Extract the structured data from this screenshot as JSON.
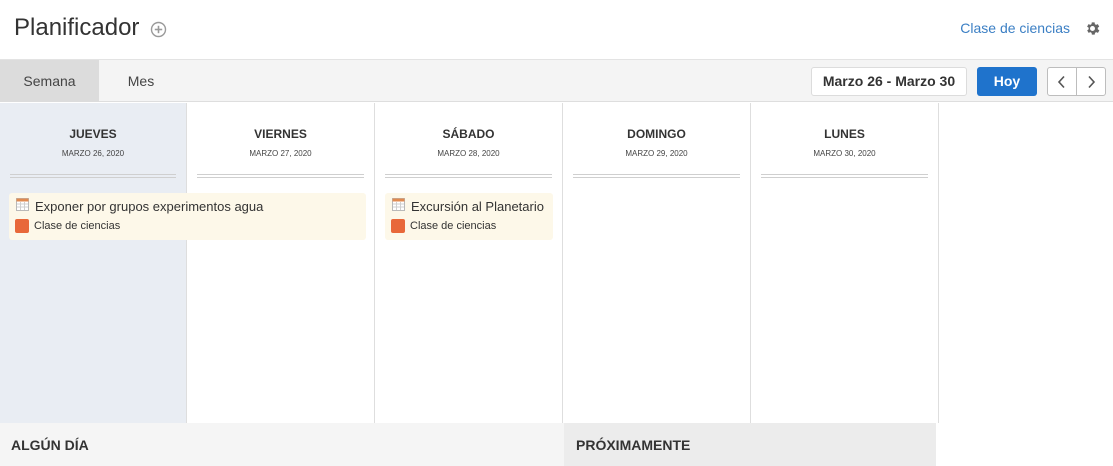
{
  "header": {
    "title": "Planificador",
    "class_link": "Clase de ciencias",
    "add_icon": "plus-circle-icon",
    "settings_icon": "gear-icon"
  },
  "toolbar": {
    "tabs": [
      {
        "label": "Semana",
        "active": true
      },
      {
        "label": "Mes",
        "active": false
      }
    ],
    "date_range": "Marzo 26 - Marzo 30",
    "today_label": "Hoy",
    "prev_icon": "chevron-left-icon",
    "next_icon": "chevron-right-icon"
  },
  "days": [
    {
      "name": "JUEVES",
      "date": "MARZO 26, 2020",
      "today": true
    },
    {
      "name": "VIERNES",
      "date": "MARZO 27, 2020",
      "today": false
    },
    {
      "name": "SÁBADO",
      "date": "MARZO 28, 2020",
      "today": false
    },
    {
      "name": "DOMINGO",
      "date": "MARZO 29, 2020",
      "today": false
    },
    {
      "name": "LUNES",
      "date": "MARZO 30, 2020",
      "today": false
    }
  ],
  "events": [
    {
      "title": "Exponer por grupos experimentos agua",
      "class": "Clase de ciencias",
      "icon": "calendar-icon",
      "color": "#e8683a"
    },
    {
      "title": "Excursión al Planetario",
      "class": "Clase de ciencias",
      "icon": "calendar-icon",
      "color": "#e8683a"
    }
  ],
  "sections": {
    "someday": "ALGÚN DÍA",
    "upcoming": "PRÓXIMAMENTE"
  },
  "colors": {
    "accent": "#1f73cc",
    "link": "#3b7fc4",
    "today_column": "#e9edf3",
    "event_background": "#fdf8e9",
    "class_color": "#e8683a"
  }
}
